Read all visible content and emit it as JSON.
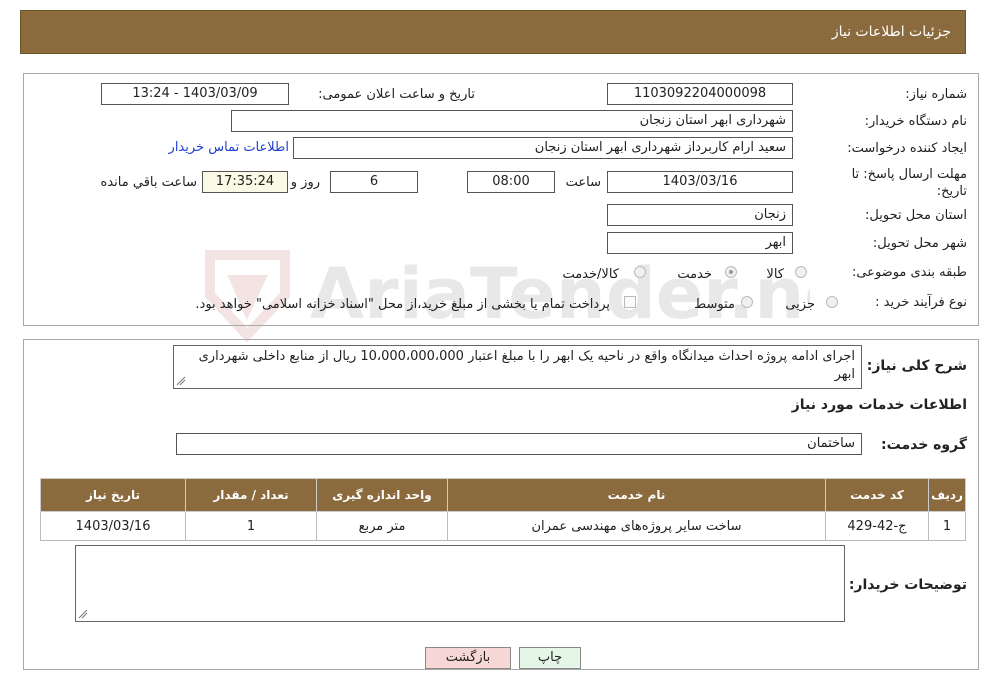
{
  "header": {
    "title": "جزئیات اطلاعات نیاز"
  },
  "form": {
    "need_number_label": "شماره نیاز:",
    "need_number": "1103092204000098",
    "announce_label": "تاریخ و ساعت اعلان عمومی:",
    "announce_value": "1403/03/09 - 13:24",
    "buyer_org_label": "نام دستگاه خریدار:",
    "buyer_org": "شهرداری ابهر استان زنجان",
    "requester_label": "ایجاد کننده درخواست:",
    "requester": "سعید ارام کاربرداز  شهرداری ابهر استان زنجان",
    "contact_link": "اطلاعات تماس خریدار",
    "deadline_label": "مهلت ارسال پاسخ: تا تاریخ:",
    "deadline_date": "1403/03/16",
    "time_label": "ساعت",
    "deadline_time": "08:00",
    "days_value": "6",
    "days_label": "روز و",
    "remaining_time": "17:35:24",
    "remaining_label": "ساعت باقي مانده",
    "province_label": "استان محل تحویل:",
    "province": "زنجان",
    "city_label": "شهر محل تحویل:",
    "city": "ابهر",
    "category_label": "طبقه بندی موضوعی:",
    "category_options": [
      "کالا",
      "خدمت",
      "کالا/خدمت"
    ],
    "category_selected": "خدمت",
    "purchase_type_label": "نوع فرآیند خرید :",
    "purchase_options": [
      "جزیی",
      "متوسط"
    ],
    "payment_note": "پرداخت تمام یا بخشی از مبلغ خرید،از محل \"اسناد خزانه اسلامی\" خواهد بود."
  },
  "description": {
    "label": "شرح کلی نیاز:",
    "text": "اجرای ادامه پروژه احداث میدانگاه واقع در ناحیه یک ابهر  را با مبلغ اعتبار 10،000،000،000 ریال از منابع داخلی شهرداری ابهر"
  },
  "services": {
    "section_title": "اطلاعات خدمات مورد نیاز",
    "group_label": "گروه خدمت:",
    "group_value": "ساختمان",
    "columns": [
      "ردیف",
      "کد خدمت",
      "نام خدمت",
      "واحد اندازه گیری",
      "تعداد / مقدار",
      "تاریخ نیاز"
    ],
    "rows": [
      [
        "1",
        "ج-42-429",
        "ساخت سایر پروژه‌های مهندسی عمران",
        "متر مربع",
        "1",
        "1403/03/16"
      ]
    ]
  },
  "buyer_notes": {
    "label": "توضیحات خریدار:",
    "text": ""
  },
  "buttons": {
    "print": "چاپ",
    "back": "بازگشت"
  },
  "watermark": {
    "text": "AriaTender.neT"
  },
  "colors": {
    "header_bg": "#8b6b3d",
    "link": "#1f3fd0",
    "back_button": "#f7d6d6",
    "print_button": "#e6f6e6"
  }
}
